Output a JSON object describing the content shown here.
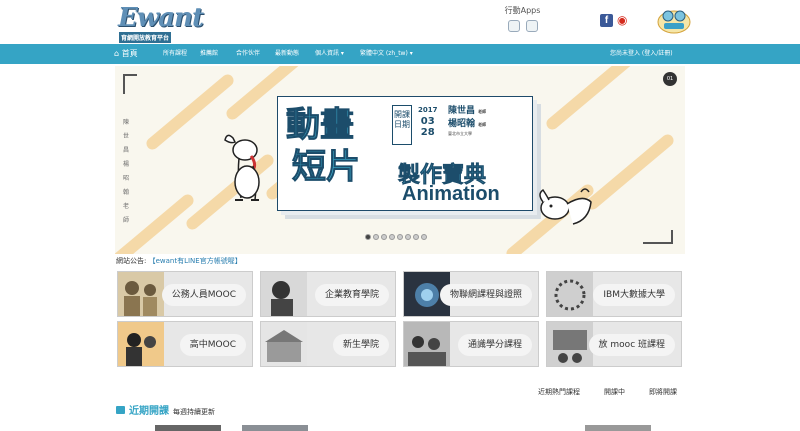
{
  "header": {
    "logo_text": "Ewant",
    "logo_subtitle": "育網開放教育平台",
    "apps_label": "行動Apps",
    "facebook_icon": "f",
    "weibo_icon": "weibo",
    "mascot_alt": "mascot"
  },
  "nav": {
    "items": [
      "首頁",
      "所有課程",
      "推薦館",
      "合作伙伴",
      "最新動態",
      "個人資訊 ▾",
      "繁體中文 (zh_tw) ▾"
    ],
    "login": "您尚未登入 (登入/註冊)"
  },
  "banner": {
    "title_line1": "動畫",
    "title_line2": "短片",
    "subtitle": "製作寶典",
    "english": "Animation",
    "date_tag": "開課日期",
    "year": "2017",
    "month": "03",
    "day": "28",
    "lecturer1": "陳世昌",
    "lecturer2": "楊昭翰",
    "lecturer_role1": "老師",
    "lecturer_role2": "老師",
    "venue": "臺北市立大學",
    "vertical_text": "陳世昌 楊昭翰 老師",
    "badge": "01",
    "slide_count": 8,
    "active_slide": 0
  },
  "announcement": {
    "label": "網站公告:",
    "link": "【ewant有LINE官方帳號喔】"
  },
  "tiles": [
    {
      "label": "公務人員MOOC"
    },
    {
      "label": "企業教育學院"
    },
    {
      "label": "物聯網課程與證照"
    },
    {
      "label": "IBM大數據大學"
    },
    {
      "label": "高中MOOC"
    },
    {
      "label": "新生學院"
    },
    {
      "label": "通識學分課程"
    },
    {
      "label": "放 mooc 班課程"
    }
  ],
  "tabs": [
    "近期熱門課程",
    "開課中",
    "即將開課"
  ],
  "section": {
    "title": "近期開課",
    "subtitle": "每週持續更新"
  },
  "colors": {
    "nav": "#35a4c5",
    "accent": "#3eb0d0",
    "banner_bg": "#f9f7ee"
  }
}
